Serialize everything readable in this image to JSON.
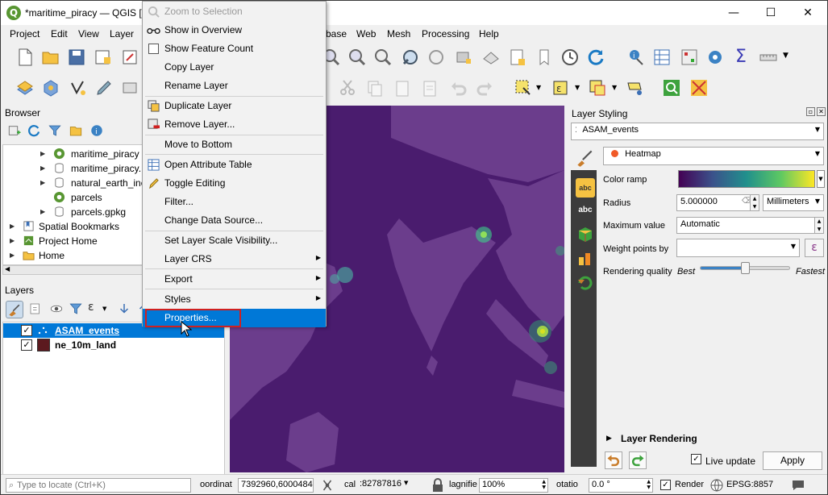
{
  "window": {
    "title": "*maritime_piracy — QGIS [",
    "minimize": "—",
    "maximize": "☐",
    "close": "✕"
  },
  "menu": [
    "Project",
    "Edit",
    "View",
    "Layer",
    "base",
    "Web",
    "Mesh",
    "Processing",
    "Help"
  ],
  "browser": {
    "title": "Browser",
    "items": [
      {
        "label": "maritime_piracy",
        "icon": "qgis-project-icon"
      },
      {
        "label": "maritime_piracy.",
        "icon": "database-icon"
      },
      {
        "label": "natural_earth_inc",
        "icon": "database-icon"
      },
      {
        "label": "parcels",
        "icon": "qgis-project-icon"
      },
      {
        "label": "parcels.gpkg",
        "icon": "database-icon"
      },
      {
        "label": "Spatial Bookmarks",
        "icon": "bookmark-icon"
      },
      {
        "label": "Project Home",
        "icon": "project-home-icon"
      },
      {
        "label": "Home",
        "icon": "folder-icon"
      }
    ]
  },
  "layers": {
    "title": "Layers",
    "items": [
      {
        "label": "ASAM_events",
        "checked": true,
        "selected": true
      },
      {
        "label": "ne_10m_land",
        "checked": true,
        "selected": false,
        "swatch": "#5c1a1f"
      }
    ]
  },
  "context_menu": {
    "items": [
      {
        "label": "Zoom to Selection",
        "disabled": true,
        "icon": "zoom-selection-icon"
      },
      {
        "label": "Show in Overview",
        "icon": "overview-icon"
      },
      {
        "label": "Show Feature Count",
        "checkbox": true
      },
      {
        "label": "Copy Layer"
      },
      {
        "label": "Rename Layer"
      },
      {
        "label": "Duplicate Layer",
        "icon": "duplicate-icon"
      },
      {
        "label": "Remove Layer...",
        "icon": "remove-icon"
      },
      {
        "label": "Move to Bottom"
      },
      {
        "label": "Open Attribute Table",
        "icon": "table-icon"
      },
      {
        "label": "Toggle Editing",
        "icon": "pencil-icon"
      },
      {
        "label": "Filter..."
      },
      {
        "label": "Change Data Source..."
      },
      {
        "label": "Set Layer Scale Visibility..."
      },
      {
        "label": "Layer CRS",
        "submenu": true
      },
      {
        "label": "Export",
        "submenu": true
      },
      {
        "label": "Styles",
        "submenu": true
      },
      {
        "label": "Properties...",
        "highlighted": true
      }
    ]
  },
  "styling": {
    "title": "Layer Styling",
    "layer": "ASAM_events",
    "renderer": "Heatmap",
    "color_ramp_label": "Color ramp",
    "radius_label": "Radius",
    "radius_value": "5.000000",
    "radius_unit": "Millimeters",
    "max_value_label": "Maximum value",
    "max_value": "Automatic",
    "weight_label": "Weight points by",
    "weight_value": "",
    "quality_label": "Rendering quality",
    "quality_best": "Best",
    "quality_fastest": "Fastest",
    "quality_level": 0.5,
    "layer_rendering": "Layer Rendering",
    "live_update": "Live update",
    "apply": "Apply"
  },
  "status": {
    "locate_placeholder": "Type to locate (Ctrl+K)",
    "coord_label": "oordinat",
    "coord_value": "7392960,6000484",
    "scale_label": "cal",
    "scale_value": ":82787816",
    "magnifier_label": "lagnifie",
    "magnifier_value": "100%",
    "rotation_label": "otatio",
    "rotation_value": "0.0 °",
    "render_label": "Render",
    "crs": "EPSG:8857"
  },
  "colors": {
    "map_bg": "#4a1c6e",
    "land": "#6b3d8c",
    "heat": "#c8d600",
    "highlight": "#0078d7",
    "accent_red": "#d02020"
  }
}
